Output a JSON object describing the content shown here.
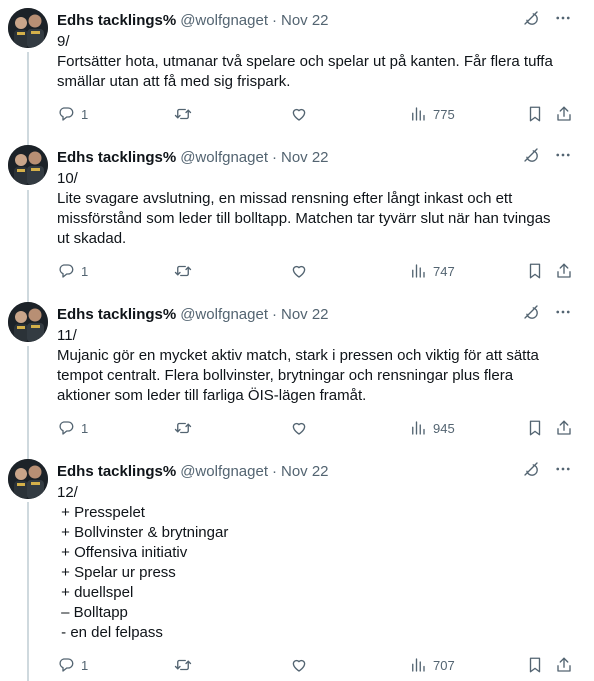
{
  "author": {
    "name": "Edhs tacklings%",
    "handle": "@wolfgnaget",
    "date": "Nov 22",
    "separator": "·"
  },
  "tweets": [
    {
      "lines": [
        "9/",
        "Fortsätter hota, utmanar två spelare och spelar ut på kanten. Får flera tuffa",
        "smällar utan att få med sig frispark."
      ],
      "replies": "1",
      "views": "775"
    },
    {
      "lines": [
        "10/",
        "Lite svagare avslutning, en missad rensning efter långt inkast och ett",
        "missförstånd som leder till bolltapp. Matchen tar tyvärr slut när han tvingas",
        "ut skadad."
      ],
      "replies": "1",
      "views": "747"
    },
    {
      "lines": [
        "11/",
        "Mujanic gör en mycket aktiv match, stark i pressen och viktig för att sätta",
        "tempot centralt. Flera bollvinster, brytningar och rensningar plus flera",
        "aktioner som leder till farliga ÖIS-lägen framåt."
      ],
      "replies": "1",
      "views": "945"
    },
    {
      "lines": [
        "12/",
        " + Presspelet",
        " + Bollvinster & brytningar",
        " + Offensiva initiativ",
        " + Spelar ur press",
        " + duellspel",
        " – Bolltapp",
        " - en del felpass"
      ],
      "replies": "1",
      "views": "707"
    }
  ],
  "icons": {
    "grok": "grok-icon",
    "more": "more-icon",
    "reply": "reply-icon",
    "retweet": "retweet-icon",
    "like": "like-icon",
    "views": "views-icon",
    "bookmark": "bookmark-icon",
    "share": "share-icon"
  },
  "colors": {
    "text": "#0f1419",
    "secondary": "#536471",
    "thread_line": "#cfd9de"
  }
}
